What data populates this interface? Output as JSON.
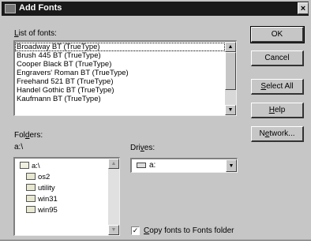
{
  "title_bar": {
    "title": "Add Fonts",
    "close_glyph": "×"
  },
  "list_of_fonts": {
    "label_prefix": "",
    "label_accel": "L",
    "label_rest": "ist of fonts:",
    "items": [
      "Broadway BT (TrueType)",
      "Brush 445 BT (TrueType)",
      "Cooper Black BT (TrueType)",
      "Engravers' Roman BT (TrueType)",
      "Freehand 521 BT (TrueType)",
      "Handel Gothic BT (TrueType)",
      "Kaufmann BT (TrueType)"
    ]
  },
  "buttons": {
    "ok": "OK",
    "cancel": "Cancel",
    "select_all_accel": "S",
    "select_all_rest": "elect All",
    "help_accel": "H",
    "help_rest": "elp",
    "network_prefix": "N",
    "network_accel": "e",
    "network_rest": "twork..."
  },
  "folders": {
    "label_prefix": "Fol",
    "label_accel": "d",
    "label_rest": "ers:",
    "current_path": "a:\\",
    "items": [
      {
        "name": "a:\\",
        "icon": "open-folder-icon"
      },
      {
        "name": "os2",
        "icon": "folder-icon"
      },
      {
        "name": "utility",
        "icon": "folder-icon"
      },
      {
        "name": "win31",
        "icon": "folder-icon"
      },
      {
        "name": "win95",
        "icon": "folder-icon"
      }
    ]
  },
  "drives": {
    "label_prefix": "Dri",
    "label_accel": "v",
    "label_rest": "es:",
    "selected": "a:",
    "icon": "floppy-drive-icon"
  },
  "copy_option": {
    "checked": true,
    "check_glyph": "✓",
    "label_accel": "C",
    "label_rest": "opy fonts to Fonts folder"
  }
}
